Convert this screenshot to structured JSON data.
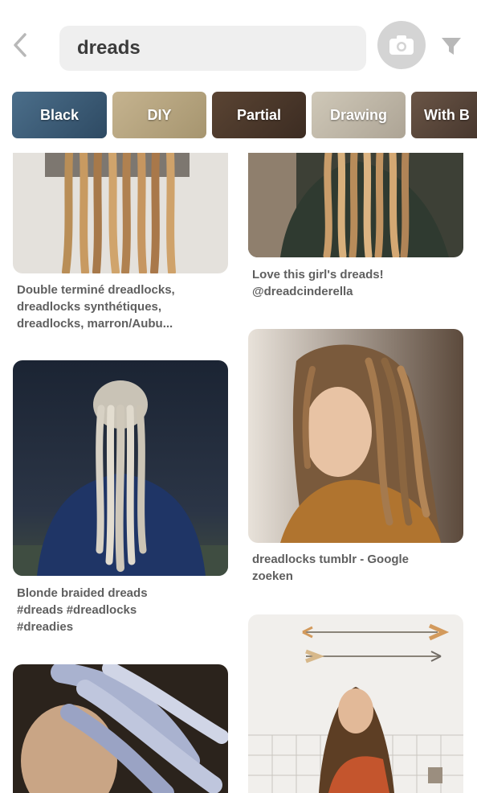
{
  "search": {
    "query": "dreads"
  },
  "icons": {
    "back": "chevron-left-icon",
    "camera": "camera-icon",
    "filter": "filter-icon"
  },
  "chips": [
    {
      "label": "Black"
    },
    {
      "label": "DIY"
    },
    {
      "label": "Partial"
    },
    {
      "label": "Drawing"
    },
    {
      "label": "With B"
    }
  ],
  "pins": {
    "left": [
      {
        "caption_lines": [
          "Double terminé dreadlocks,",
          "dreadlocks synthétiques,",
          "dreadlocks, marron/Aubu..."
        ]
      },
      {
        "caption_lines": [
          "Blonde braided dreads",
          "#dreads #dreadlocks",
          "#dreadies"
        ]
      },
      {
        "caption_lines": []
      }
    ],
    "right": [
      {
        "caption_lines": [
          "Love this girl's dreads!",
          "@dreadcinderella"
        ]
      },
      {
        "caption_lines": [
          "dreadlocks tumblr - Google",
          "zoeken"
        ]
      },
      {
        "caption_lines": []
      }
    ]
  },
  "colors": {
    "search_bg": "#efefef",
    "icon_gray": "#bdbdbd",
    "caption": "#5f5f5f"
  }
}
